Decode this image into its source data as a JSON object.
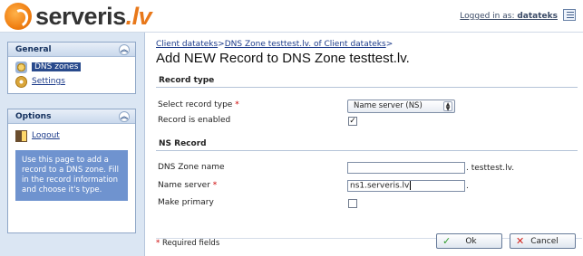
{
  "header": {
    "logo_main": "serveris",
    "logo_tld": ".lv",
    "logged_in_label": "Logged in as:",
    "logged_in_user": "datateks"
  },
  "sidebar": {
    "general": {
      "title": "General",
      "items": [
        {
          "label": "DNS zones",
          "icon": "dns-zones-icon"
        },
        {
          "label": "Settings",
          "icon": "settings-gear-icon"
        }
      ]
    },
    "options": {
      "title": "Options",
      "items": [
        {
          "label": "Logout",
          "icon": "logout-door-icon"
        }
      ],
      "hint": "Use this page to add a record to a DNS zone. Fill in the record information and choose it's type."
    }
  },
  "main": {
    "breadcrumb": {
      "link1": "Client datateks",
      "sep1": ">",
      "link2": "DNS Zone testtest.lv. of Client datateks",
      "sep2": ">"
    },
    "title": "Add NEW Record to DNS Zone testtest.lv.",
    "record_type_section": {
      "title": "Record type",
      "select_label": "Select record type",
      "select_value": "Name server (NS)",
      "enabled_label": "Record is enabled",
      "enabled_checked": "✓"
    },
    "ns_section": {
      "title": "NS Record",
      "zone_label": "DNS Zone name",
      "zone_value": "",
      "zone_suffix": ". testtest.lv.",
      "ns_label": "Name server",
      "ns_value": "ns1.serveris.lv",
      "ns_suffix": ".",
      "primary_label": "Make primary"
    },
    "required_mark": "*",
    "required_note": "Required fields",
    "ok_label": "Ok",
    "cancel_label": "Cancel"
  }
}
